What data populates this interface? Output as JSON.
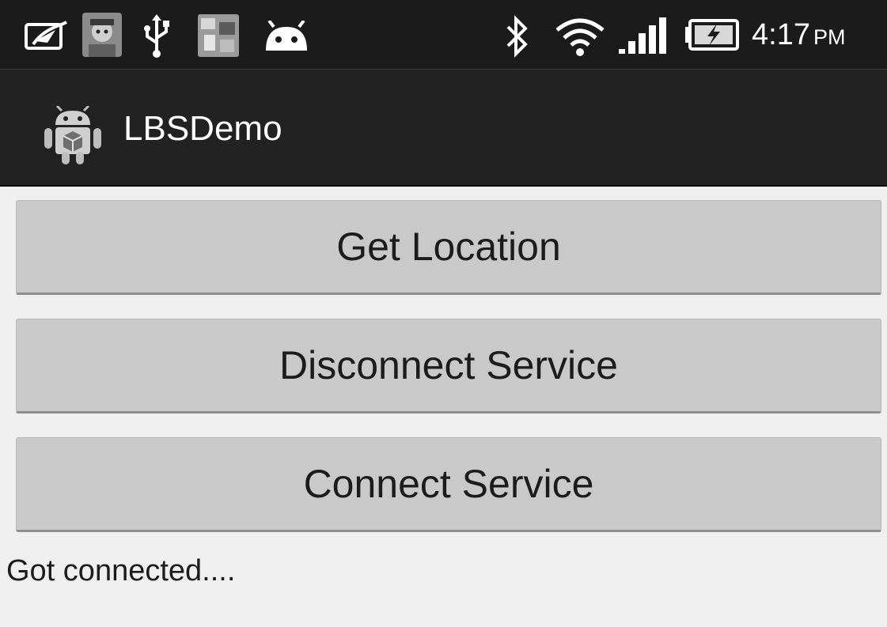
{
  "status_bar": {
    "time": "4:17",
    "ampm": "PM",
    "notification_icons": [
      "notepad-icon",
      "character-avatar-icon",
      "usb-icon",
      "game-thumbnail-icon",
      "android-head-icon"
    ],
    "system_icons": [
      "bluetooth-icon",
      "wifi-icon",
      "signal-icon",
      "battery-charging-icon"
    ]
  },
  "action_bar": {
    "title": "LBSDemo",
    "icon": "android-app-icon"
  },
  "buttons": {
    "get_location": "Get Location",
    "disconnect_service": "Disconnect Service",
    "connect_service": "Connect Service"
  },
  "status_message": "Got connected...."
}
